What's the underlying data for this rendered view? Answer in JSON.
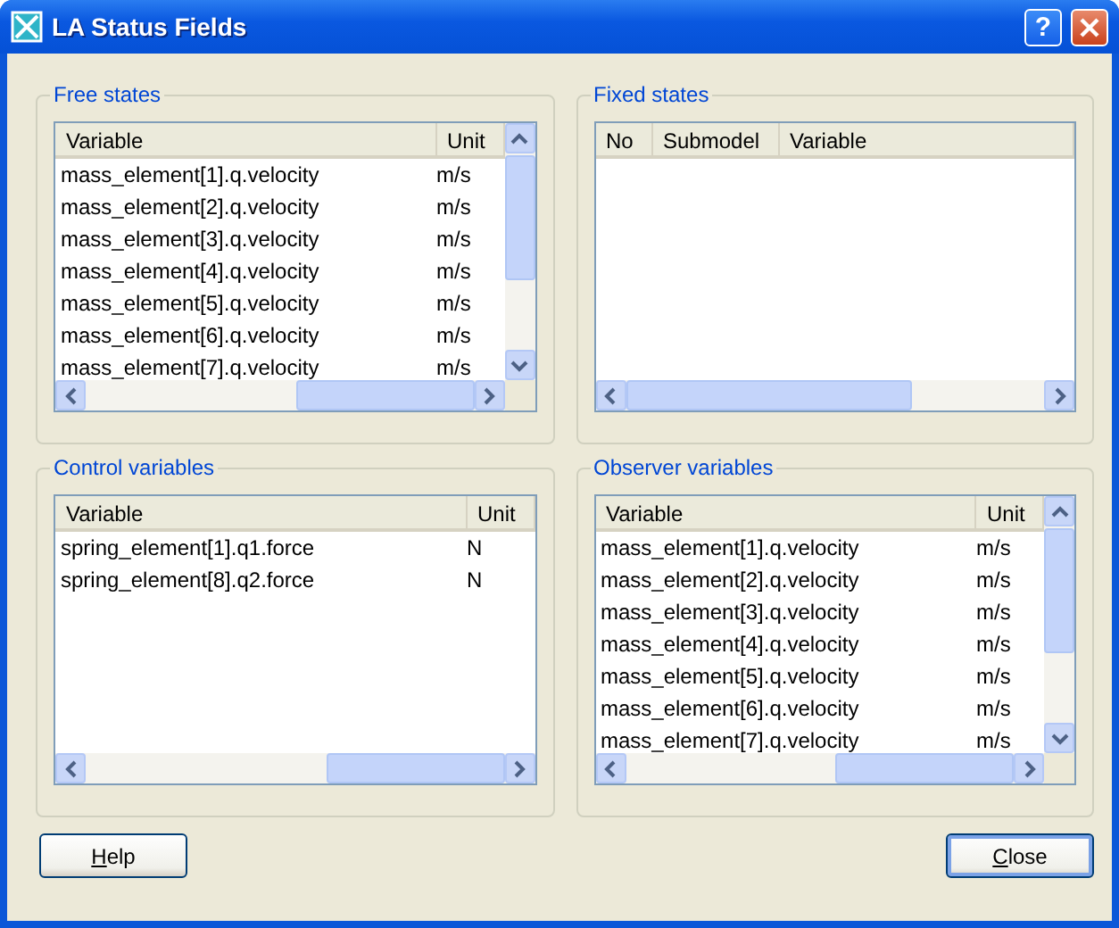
{
  "window": {
    "title": "LA Status Fields",
    "help_glyph": "?"
  },
  "groups": [
    {
      "title": "Free states",
      "columns": [
        "Variable",
        "Unit"
      ],
      "vertical_scrollbar": true,
      "rows": [
        [
          "mass_element[1].q.velocity",
          "m/s"
        ],
        [
          "mass_element[2].q.velocity",
          "m/s"
        ],
        [
          "mass_element[3].q.velocity",
          "m/s"
        ],
        [
          "mass_element[4].q.velocity",
          "m/s"
        ],
        [
          "mass_element[5].q.velocity",
          "m/s"
        ],
        [
          "mass_element[6].q.velocity",
          "m/s"
        ],
        [
          "mass_element[7].q.velocity",
          "m/s"
        ]
      ]
    },
    {
      "title": "Fixed states",
      "columns": [
        "No",
        "Submodel",
        "Variable"
      ],
      "vertical_scrollbar": false
    },
    {
      "title": "Control variables",
      "columns": [
        "Variable",
        "Unit"
      ],
      "vertical_scrollbar": false,
      "rows": [
        [
          "spring_element[1].q1.force",
          "N"
        ],
        [
          "spring_element[8].q2.force",
          "N"
        ]
      ]
    },
    {
      "title": "Observer variables",
      "columns": [
        "Variable",
        "Unit"
      ],
      "vertical_scrollbar": true,
      "rows": [
        [
          "mass_element[1].q.velocity",
          "m/s"
        ],
        [
          "mass_element[2].q.velocity",
          "m/s"
        ],
        [
          "mass_element[3].q.velocity",
          "m/s"
        ],
        [
          "mass_element[4].q.velocity",
          "m/s"
        ],
        [
          "mass_element[5].q.velocity",
          "m/s"
        ],
        [
          "mass_element[6].q.velocity",
          "m/s"
        ],
        [
          "mass_element[7].q.velocity",
          "m/s"
        ]
      ]
    }
  ],
  "buttons": [
    {
      "label": "Help",
      "default": false
    },
    {
      "label": "Close",
      "default": true
    }
  ]
}
